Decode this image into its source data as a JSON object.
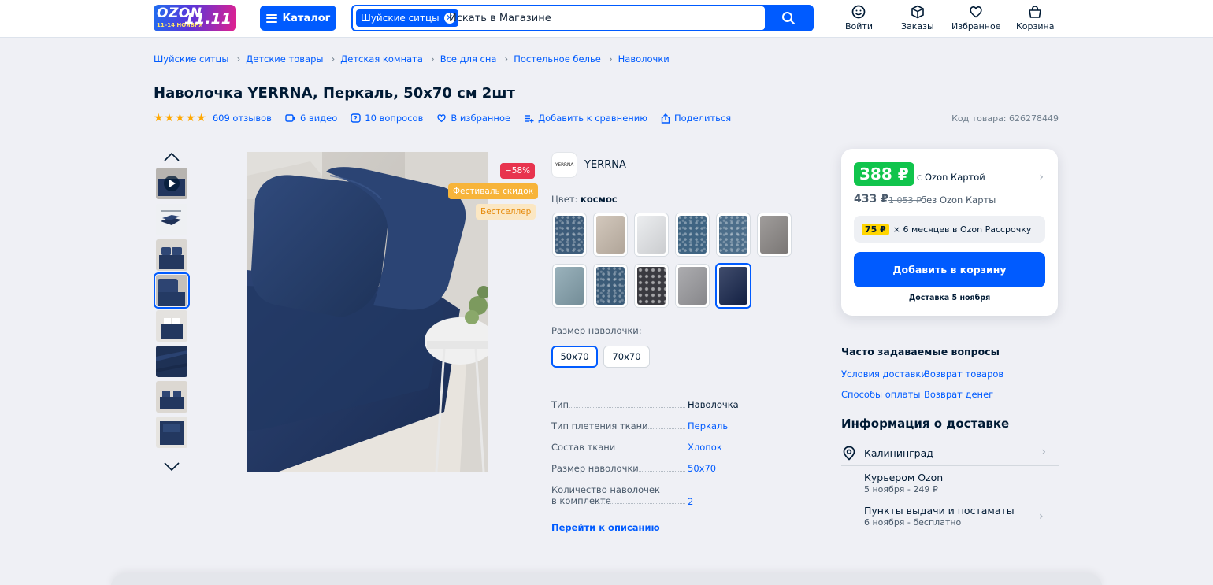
{
  "header": {
    "logo": {
      "word": "OZON",
      "dates": "11–14 НОЯБРЯ",
      "sale": "11.11"
    },
    "catalog_label": "Каталог",
    "search": {
      "chip": "Шуйские ситцы",
      "placeholder": "Искать в Магазине"
    },
    "actions": [
      {
        "label": "Войти",
        "icon": "smile-icon"
      },
      {
        "label": "Заказы",
        "icon": "box-icon"
      },
      {
        "label": "Избранное",
        "icon": "heart-icon"
      },
      {
        "label": "Корзина",
        "icon": "bag-icon"
      }
    ]
  },
  "breadcrumb": [
    "Шуйские ситцы",
    "Детские товары",
    "Детская комната",
    "Все для сна",
    "Постельное белье",
    "Наволочки"
  ],
  "product": {
    "title": "Наволочка YERRNA, Перкаль, 50х70 см 2шт",
    "rating": 5,
    "reviews": "609 отзывов",
    "videos": "6 видео",
    "questions": "10 вопросов",
    "favorite": "В избранное",
    "compare": "Добавить к сравнению",
    "share": "Поделиться",
    "code": "Код товара: 626278449"
  },
  "gallery": {
    "thumb_count": 8,
    "active_index": 3
  },
  "badges": {
    "discount": "−58%",
    "festival": "Фестиваль скидок",
    "bestseller": "Бестселлер"
  },
  "brand": {
    "logo_text": "YERRNA",
    "name": "YERRNA"
  },
  "color": {
    "label": "Цвет:",
    "value": "космос",
    "swatches": [
      {
        "color": "#3d5c7a",
        "pattern": "dots"
      },
      {
        "color": "#c9bcae",
        "pattern": "plain"
      },
      {
        "color": "#e7e9ec",
        "pattern": "plain"
      },
      {
        "color": "#3f6482",
        "pattern": "dots"
      },
      {
        "color": "#4d6e8a",
        "pattern": "dots"
      },
      {
        "color": "#8b8785",
        "pattern": "plain"
      },
      {
        "color": "#84a1ad",
        "pattern": "plain"
      },
      {
        "color": "#3b5b78",
        "pattern": "dots"
      },
      {
        "color": "#3a3a40",
        "pattern": "flowers"
      },
      {
        "color": "#9a9a9e",
        "pattern": "plain"
      },
      {
        "color": "#16254c",
        "pattern": "plain"
      }
    ],
    "selected_index": 10
  },
  "size": {
    "label": "Размер наволочки:",
    "options": [
      "50х70",
      "70х70"
    ],
    "selected_index": 0
  },
  "specs": [
    {
      "key": "Тип",
      "value": "Наволочка",
      "link": false
    },
    {
      "key": "Тип плетения ткани",
      "value": "Перкаль",
      "link": true
    },
    {
      "key": "Состав ткани",
      "value": "Хлопок",
      "link": true
    },
    {
      "key": "Размер наволочки",
      "value": "50х70",
      "link": true
    },
    {
      "key": "Количество наволочек в комплекте",
      "value": "2",
      "link": true
    }
  ],
  "goto_description": "Перейти к описанию",
  "buy": {
    "price_card": "388 ₽",
    "price_card_note": "с Ozon Картой",
    "price": "433 ₽",
    "price_old": "1 053 ₽",
    "price_note": "без Ozon Карты",
    "installment_amount": "75 ₽",
    "installment_text": "× 6 месяцев в Ozon Рассрочку",
    "add_to_cart": "Добавить в корзину",
    "delivery_date": "Доставка 5 ноября"
  },
  "faq": {
    "title": "Часто задаваемые вопросы",
    "links": [
      "Условия доставки",
      "Возврат товаров",
      "Способы оплаты",
      "Возврат денег"
    ]
  },
  "delivery": {
    "title": "Информация о доставке",
    "city": "Калининград",
    "options": [
      {
        "title": "Курьером Ozon",
        "sub": "5 ноября - 249 ₽"
      },
      {
        "title": "Пункты выдачи и постаматы",
        "sub": "6 ноября - бесплатно"
      }
    ]
  },
  "colors": {
    "accent": "#005bff",
    "green": "#10c44c",
    "star": "#ffa800"
  }
}
